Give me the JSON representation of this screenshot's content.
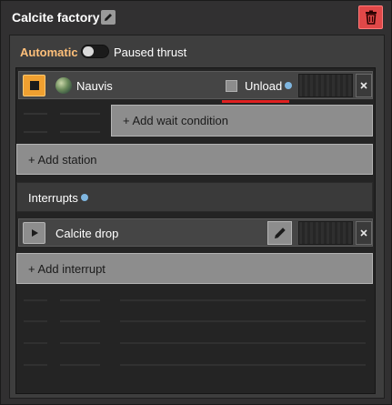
{
  "window": {
    "title": "Calcite factory",
    "edit_icon": "pencil-icon",
    "trash_icon": "trash-icon"
  },
  "mode": {
    "automatic_label": "Automatic",
    "paused_label": "Paused thrust",
    "toggle_state": "off"
  },
  "schedule": {
    "station": {
      "planet_icon": "nauvis-planet-icon",
      "name": "Nauvis",
      "unload_label": "Unload",
      "unload_checked": false
    },
    "add_wait_condition_label": "+ Add wait condition",
    "add_station_label": "+ Add station"
  },
  "interrupts": {
    "header_label": "Interrupts",
    "items": [
      {
        "name": "Calcite drop",
        "play_icon": "play-icon",
        "edit_icon": "pencil-icon"
      }
    ],
    "add_interrupt_label": "+ Add interrupt"
  },
  "colors": {
    "accent": "#ffc07a",
    "danger": "#e04848",
    "active_stop": "#f0a030",
    "highlight_underline": "#e02020"
  }
}
